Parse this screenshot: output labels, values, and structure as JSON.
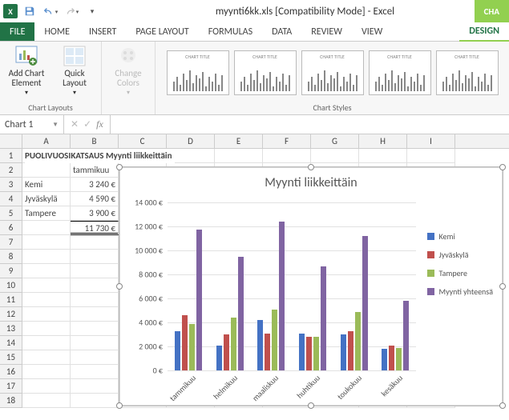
{
  "title": "myynti6kk.xls  [Compatibility Mode] - Excel",
  "context_tab": "CHA",
  "tabs": {
    "file": "FILE",
    "home": "HOME",
    "insert": "INSERT",
    "pagelayout": "PAGE LAYOUT",
    "formulas": "FORMULAS",
    "data": "DATA",
    "review": "REVIEW",
    "view": "VIEW",
    "design": "DESIGN"
  },
  "ribbon": {
    "chart_layouts_label": "Chart Layouts",
    "chart_styles_label": "Chart Styles",
    "add_chart_element": "Add Chart Element",
    "quick_layout": "Quick Layout",
    "change_colors": "Change Colors"
  },
  "name_box": "Chart 1",
  "columns": [
    "A",
    "B",
    "C",
    "D",
    "E",
    "F",
    "G",
    "H",
    "I"
  ],
  "sheet": {
    "r1_title": "PUOLIVUOSIKATSAUS Myynti liikkeittäin",
    "r2_b": "tammikuu",
    "r3_a": "Kemi",
    "r3_b": "3 240 €",
    "r4_a": "Jyväskylä",
    "r4_b": "4 590 €",
    "r5_a": "Tampere",
    "r5_b": "3 900 €",
    "r6_b": "11 730 €"
  },
  "chart_data": {
    "type": "bar",
    "title": "Myynti liikkeittäin",
    "categories": [
      "tammikuu",
      "helmikuu",
      "maaliskuu",
      "huhtikuu",
      "toukokuu",
      "kesäkuu"
    ],
    "series": [
      {
        "name": "Kemi",
        "values": [
          3240,
          2100,
          4200,
          3100,
          3000,
          1800
        ]
      },
      {
        "name": "Jyväskylä",
        "values": [
          4590,
          3000,
          3100,
          2800,
          3300,
          2100
        ]
      },
      {
        "name": "Tampere",
        "values": [
          3900,
          4400,
          5100,
          2800,
          4900,
          1900
        ]
      },
      {
        "name": "Myynti yhteensä",
        "values": [
          11730,
          9500,
          12400,
          8700,
          11200,
          5800
        ]
      }
    ],
    "ylabel": "",
    "xlabel": "",
    "y_format_suffix": " €",
    "ylim": [
      0,
      14000
    ],
    "y_step": 2000
  },
  "colors": [
    "#4472c4",
    "#c0504d",
    "#9bbb59",
    "#8064a2"
  ]
}
